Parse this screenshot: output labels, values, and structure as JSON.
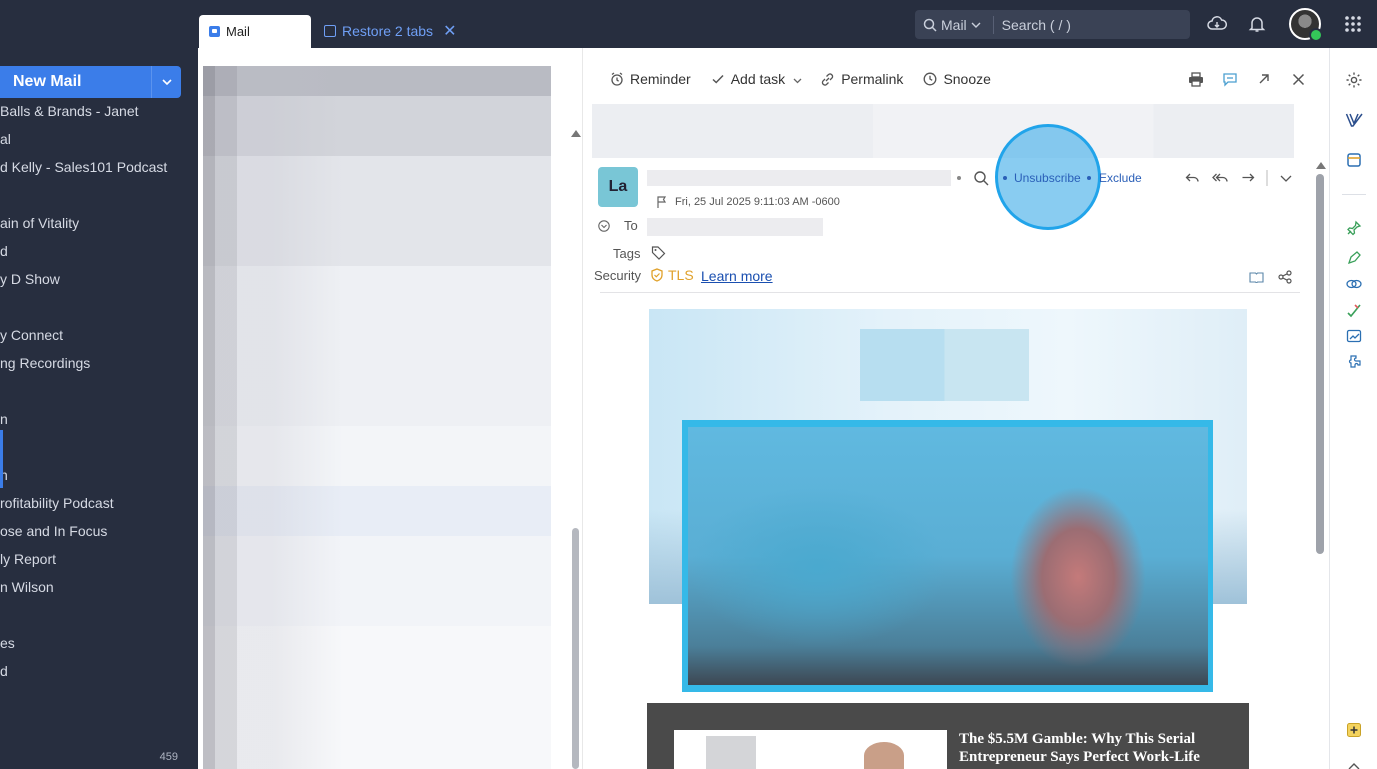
{
  "sidebar": {
    "new_mail_label": "New Mail",
    "folders": [
      "Balls & Brands - Janet",
      "al",
      "d Kelly - Sales101 Podcast",
      "",
      "ain of Vitality",
      "d",
      "y D Show",
      "",
      "y Connect",
      "ng Recordings",
      "",
      "n",
      "",
      "n",
      "rofitability Podcast",
      "ose and In Focus",
      "ly Report",
      "n Wilson",
      "",
      "es",
      "d"
    ],
    "count": "459"
  },
  "tabs": {
    "mail_label": "Mail",
    "restore_label": "Restore 2 tabs"
  },
  "search": {
    "scope": "Mail",
    "placeholder": "Search ( / )"
  },
  "toolbar": {
    "reminder": "Reminder",
    "add_task": "Add task",
    "permalink": "Permalink",
    "snooze": "Snooze"
  },
  "message": {
    "sender_initials": "La",
    "unsubscribe": "Unsubscribe",
    "exclude": "Exclude",
    "date": "Fri, 25 Jul 2025 9:11:03 AM -0600",
    "to_label": "To",
    "tags_label": "Tags",
    "security_label": "Security",
    "tls": "TLS",
    "learn_more": "Learn more"
  },
  "body": {
    "article_title": "The $5.5M Gamble: Why This Serial Entrepreneur Says Perfect Work-Life"
  },
  "colors": {
    "chrome": "#272e3f",
    "accent": "#3b7de9",
    "highlight": "#21a4ea",
    "tls": "#e0a12b"
  }
}
